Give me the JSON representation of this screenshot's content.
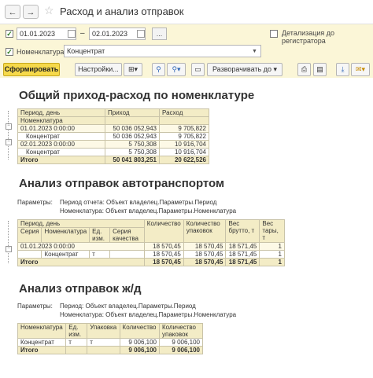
{
  "window": {
    "title": "Расход и анализ отправок",
    "back_icon": "←",
    "forward_icon": "→",
    "star_icon": "☆"
  },
  "settings": {
    "period_start": "01.01.2023",
    "period_separator": "–",
    "period_end": "02.01.2023",
    "period_more": "...",
    "detail_label": "Детализация до регистратора",
    "nomenclature_label": "Номенклатура:",
    "nomenclature_value": "Концентрат"
  },
  "toolbar": {
    "generate_label": "Сформировать",
    "settings_label": "Настройки...",
    "expand_label": "Разворачивать до"
  },
  "report1": {
    "title": "Общий приход-расход по номенклатуре",
    "headers": [
      "Период, день",
      "Приход",
      "Расход"
    ],
    "subheader": "Номенклатура",
    "rows": [
      {
        "kind": "group",
        "label": "01.01.2023 0:00:00",
        "in": "50 036 052,943",
        "out": "9 705,822"
      },
      {
        "kind": "item",
        "label": "Концентрат",
        "in": "50 036 052,943",
        "out": "9 705,822"
      },
      {
        "kind": "group",
        "label": "02.01.2023 0:00:00",
        "in": "5 750,308",
        "out": "10 916,704"
      },
      {
        "kind": "item",
        "label": "Концентрат",
        "in": "5 750,308",
        "out": "10 916,704"
      },
      {
        "kind": "total",
        "label": "Итого",
        "in": "50 041 803,251",
        "out": "20 622,526"
      }
    ]
  },
  "report2": {
    "title": "Анализ отправок автотранспортом",
    "params_label": "Параметры:",
    "param_lines": [
      "Период отчета: Объект владелец.Параметры.Период",
      "Номенклатура: Объект владелец.Параметры.Номенклатура"
    ],
    "header_row1": [
      "Период, день",
      "",
      "",
      "",
      "Количество",
      "Количество упаковок",
      "Вес брутто, т",
      "Вес тары, т"
    ],
    "header_row2": [
      "Серия",
      "Номенклатура",
      "Ед. изм.",
      "Серия качества"
    ],
    "rows": [
      {
        "kind": "group",
        "label": "01.01.2023 0:00:00",
        "vals": [
          "18 570,45",
          "18 570,45",
          "18 571,45",
          "1"
        ]
      },
      {
        "kind": "item",
        "series": "",
        "nom": "Концентрат",
        "unit": "т",
        "qual": "",
        "vals": [
          "18 570,45",
          "18 570,45",
          "18 571,45",
          "1"
        ]
      },
      {
        "kind": "total",
        "label": "Итого",
        "vals": [
          "18 570,45",
          "18 570,45",
          "18 571,45",
          "1"
        ]
      }
    ]
  },
  "report3": {
    "title": "Анализ отправок ж/д",
    "params_label": "Параметры:",
    "param_lines": [
      "Период: Объект владелец.Параметры.Период",
      "Номенклатура: Объект владелец.Параметры.Номенклатура"
    ],
    "headers": [
      "Номенклатура",
      "Ед. изм.",
      "Упаковка",
      "Количество",
      "Количество упаковок"
    ],
    "rows": [
      {
        "kind": "item",
        "nom": "Концентрат",
        "unit": "т",
        "pack": "т",
        "qty": "9 006,100",
        "packs": "9 006,100"
      },
      {
        "kind": "total",
        "nom": "Итого",
        "unit": "",
        "pack": "",
        "qty": "9 006,100",
        "packs": "9 006,100"
      }
    ]
  }
}
